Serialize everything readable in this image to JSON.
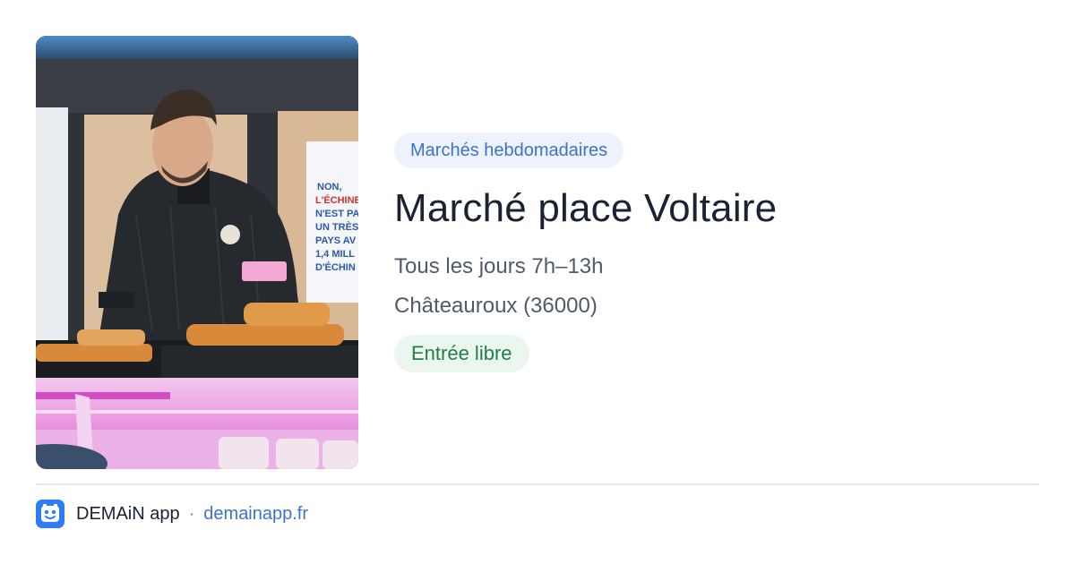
{
  "image": {
    "alt": "Marchand au comptoir",
    "poster_lines": [
      "NON,",
      "L'ÉCHINE",
      "N'EST PA",
      "UN TRÈS",
      "PAYS AV",
      "1,4 MILL",
      "D'ÉCHIN"
    ]
  },
  "category": {
    "label": "Marchés hebdomadaires"
  },
  "title": "Marché place Voltaire",
  "schedule": "Tous les jours 7h–13h",
  "location": "Châteauroux (36000)",
  "access": {
    "label": "Entrée libre"
  },
  "footer": {
    "icon": "demain-app-icon",
    "app_name": "DEMAiN app",
    "separator": "·",
    "url": "demainapp.fr"
  },
  "colors": {
    "accent": "#3a74cf",
    "chip_bg": "#eef3fb",
    "access_bg": "#eaf6ee",
    "access_text": "#228046",
    "title": "#1a2233",
    "meta": "#505a6b",
    "app_icon_bg": "#2f7cf6"
  }
}
